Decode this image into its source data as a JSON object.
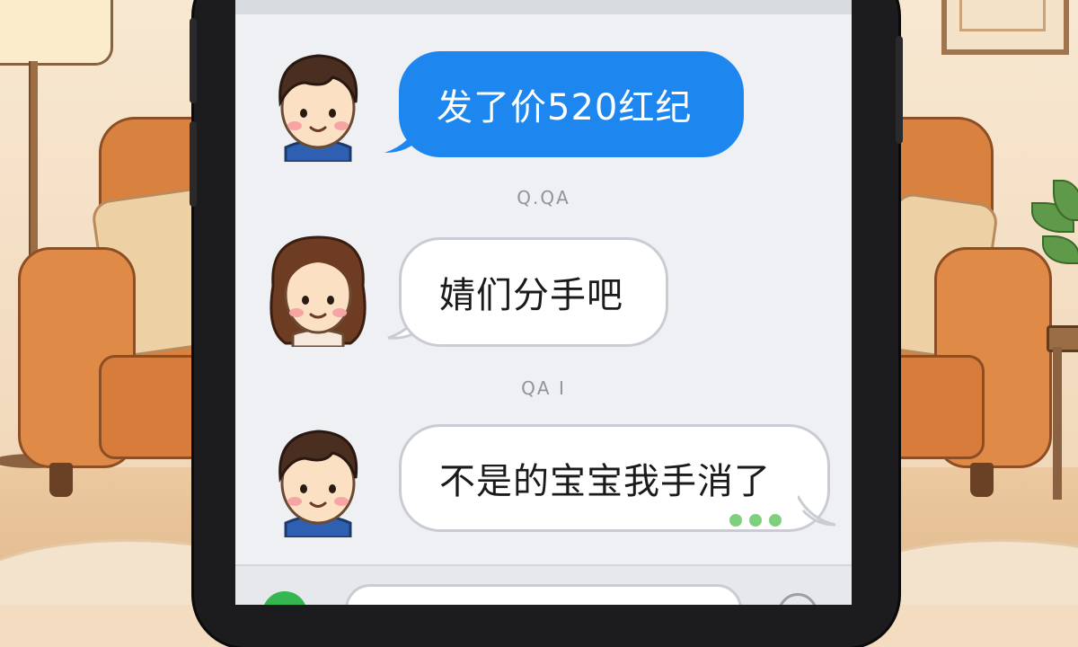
{
  "chat": {
    "messages": [
      {
        "sender": "boy",
        "type": "sent",
        "text": "发了价520红纪"
      },
      {
        "timestamp": "Q.QA"
      },
      {
        "sender": "girl",
        "type": "received",
        "text": "婧们分手吧"
      },
      {
        "timestamp": "QA I"
      },
      {
        "sender": "boy",
        "type": "received",
        "text": "不是的宝宝我手消了",
        "status": "typing-dots"
      }
    ]
  },
  "composer": {
    "input_value": "",
    "icons": [
      "voice-icon",
      "emoji-icon"
    ]
  },
  "colors": {
    "sent_bubble": "#1e87ef",
    "received_bubble": "#ffffff",
    "screen_bg": "#eef0f4",
    "phone_frame": "#1c1c1e",
    "typing_dots": "#7fd07c"
  }
}
